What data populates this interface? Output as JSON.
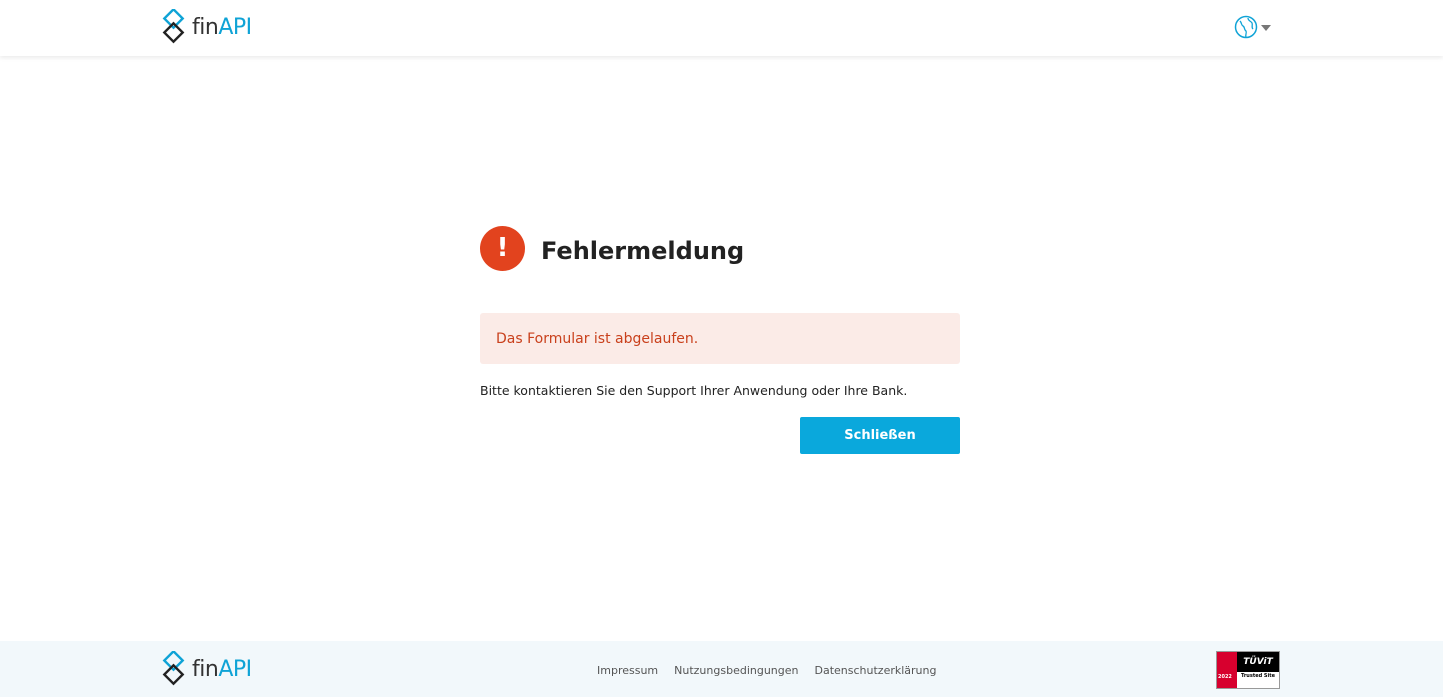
{
  "brand": {
    "fin": "fin",
    "api": "API",
    "accent": "#0fa3d6"
  },
  "header": {
    "language_icon": "globe-icon"
  },
  "error": {
    "icon_glyph": "!",
    "title": "Fehlermeldung",
    "alert_message": "Das Formular ist abgelaufen.",
    "support_text": "Bitte kontaktieren Sie den Support Ihrer Anwendung oder Ihre Bank.",
    "close_label": "Schließen",
    "icon_color": "#e2431e",
    "button_color": "#0aa8dc"
  },
  "footer": {
    "links": [
      "Impressum",
      "Nutzungsbedingungen",
      "Datenschutzerklärung"
    ],
    "certificate": {
      "brand": "TÜViT",
      "label": "Trusted Site",
      "year": "2022"
    }
  }
}
